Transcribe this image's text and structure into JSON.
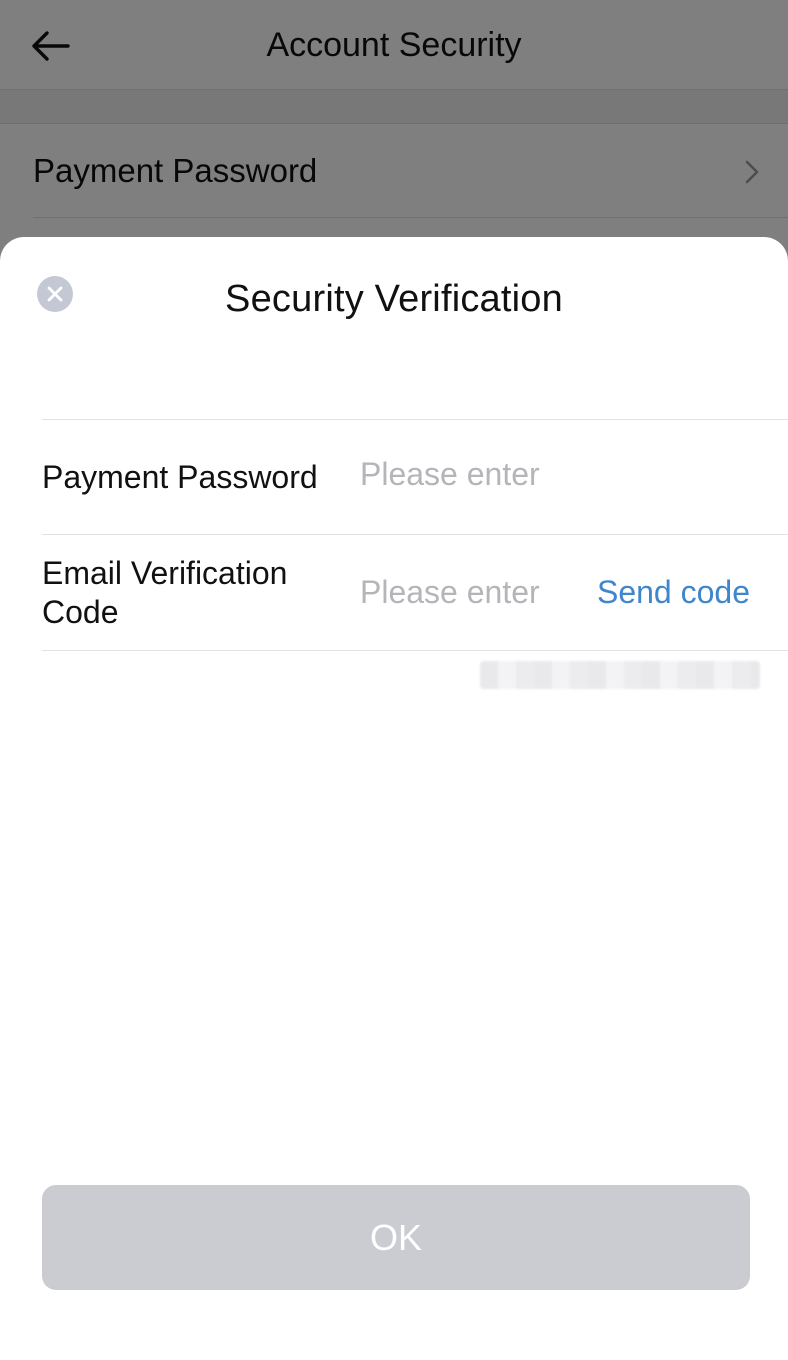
{
  "header": {
    "title": "Account Security",
    "back_icon": "arrow-left-icon"
  },
  "background_list": {
    "items": [
      {
        "label": "Payment Password",
        "icon": "chevron-right-icon"
      }
    ]
  },
  "dialog": {
    "title": "Security Verification",
    "close_icon": "close-icon",
    "fields": [
      {
        "label": "Payment Password",
        "placeholder": "Please enter",
        "value": ""
      },
      {
        "label": "Email Verification Code",
        "placeholder": "Please enter",
        "value": ""
      }
    ],
    "send_code_label": "Send code",
    "ok_label": "OK"
  },
  "colors": {
    "accent": "#3f86cc",
    "button_disabled": "#cbccd1",
    "placeholder": "#b5b5b9",
    "overlay": "rgba(0,0,0,0.5)"
  }
}
